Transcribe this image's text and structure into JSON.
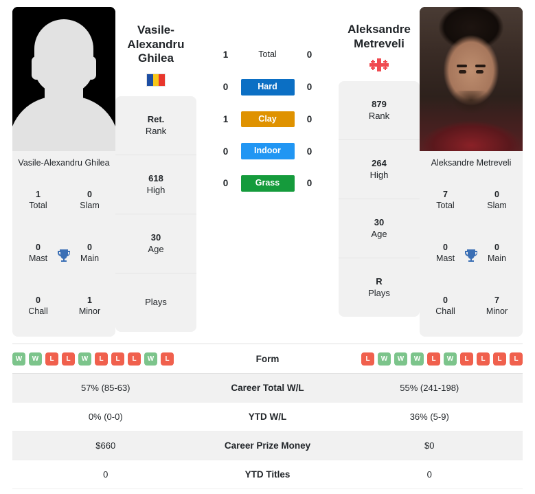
{
  "players": {
    "left": {
      "name_heading": "Vasile-Alexandru Ghilea",
      "name_line1": "Vasile-",
      "name_line2": "Alexandru",
      "name_line3": "Ghilea",
      "card_name": "Vasile-Alexandru Ghilea",
      "flag": "romania-flag-icon",
      "photo": "player-photo-placeholder-silhouette",
      "info": [
        {
          "value": "Ret.",
          "label": "Rank"
        },
        {
          "value": "618",
          "label": "High"
        },
        {
          "value": "30",
          "label": "Age"
        },
        {
          "value": "",
          "label": "Plays"
        }
      ],
      "titles": [
        {
          "value": "1",
          "label": "Total"
        },
        {
          "value": "0",
          "label": "Slam"
        },
        {
          "value": "0",
          "label": "Mast"
        },
        {
          "value": "0",
          "label": "Main"
        },
        {
          "value": "0",
          "label": "Chall"
        },
        {
          "value": "1",
          "label": "Minor"
        }
      ],
      "form": [
        "W",
        "W",
        "L",
        "L",
        "W",
        "L",
        "L",
        "L",
        "W",
        "L"
      ]
    },
    "right": {
      "name_heading": "Aleksandre Metreveli",
      "name_line1": "Aleksandre",
      "name_line2": "Metreveli",
      "card_name": "Aleksandre Metreveli",
      "flag": "georgia-flag-icon",
      "photo": "player-photo-portrait",
      "info": [
        {
          "value": "879",
          "label": "Rank"
        },
        {
          "value": "264",
          "label": "High"
        },
        {
          "value": "30",
          "label": "Age"
        },
        {
          "value": "R",
          "label": "Plays"
        }
      ],
      "titles": [
        {
          "value": "7",
          "label": "Total"
        },
        {
          "value": "0",
          "label": "Slam"
        },
        {
          "value": "0",
          "label": "Mast"
        },
        {
          "value": "0",
          "label": "Main"
        },
        {
          "value": "0",
          "label": "Chall"
        },
        {
          "value": "7",
          "label": "Minor"
        }
      ],
      "form": [
        "L",
        "W",
        "W",
        "W",
        "L",
        "W",
        "L",
        "L",
        "L",
        "L"
      ]
    }
  },
  "surfaces": [
    {
      "label": "Total",
      "left": "1",
      "right": "0",
      "color": ""
    },
    {
      "label": "Hard",
      "left": "0",
      "right": "0",
      "color": "#0b6fc4"
    },
    {
      "label": "Clay",
      "left": "1",
      "right": "0",
      "color": "#df9200"
    },
    {
      "label": "Indoor",
      "left": "0",
      "right": "0",
      "color": "#2196f3"
    },
    {
      "label": "Grass",
      "left": "0",
      "right": "0",
      "color": "#159b3c"
    }
  ],
  "form_section": {
    "label": "Form"
  },
  "stats_rows": [
    {
      "left": "57% (85-63)",
      "label": "Career Total W/L",
      "right": "55% (241-198)"
    },
    {
      "left": "0% (0-0)",
      "label": "YTD W/L",
      "right": "36% (5-9)"
    },
    {
      "left": "$660",
      "label": "Career Prize Money",
      "right": "$0"
    },
    {
      "left": "0",
      "label": "YTD Titles",
      "right": "0"
    }
  ],
  "colors": {
    "win_badge": "#7cc48b",
    "loss_badge": "#f0604d",
    "card_bg": "#f1f1f1",
    "trophy": "#3b6fb5"
  },
  "icons": {
    "trophy": "trophy-icon"
  }
}
